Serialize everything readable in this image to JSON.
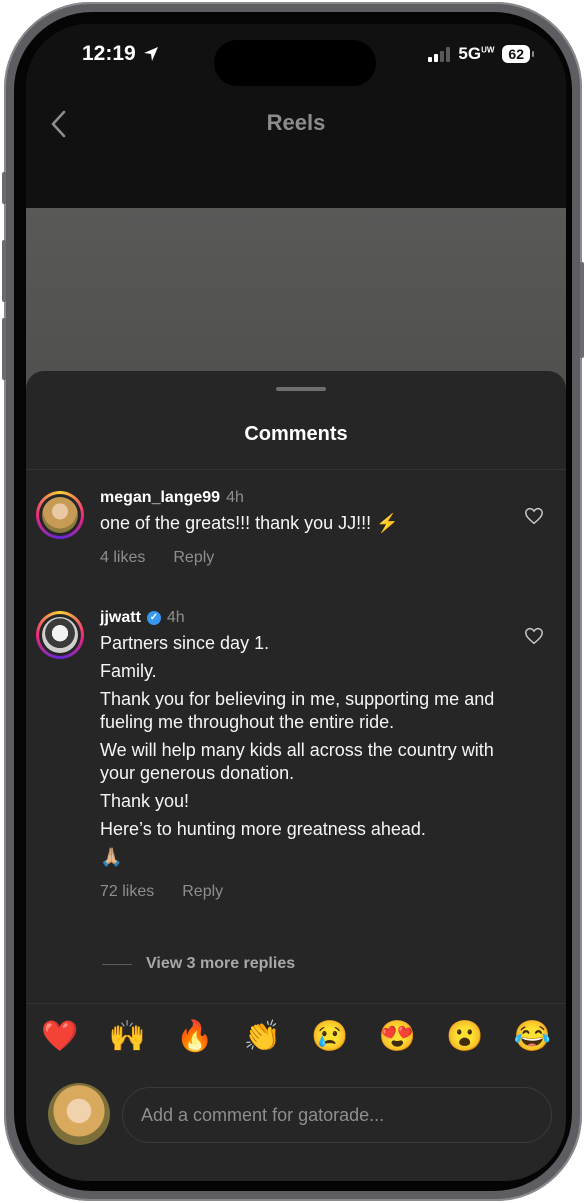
{
  "status_bar": {
    "time": "12:19",
    "network": "5G",
    "network_sup": "UW",
    "battery": "62"
  },
  "header": {
    "title": "Reels"
  },
  "comments_sheet": {
    "title": "Comments",
    "comments": [
      {
        "username": "megan_lange99",
        "time_ago": "4h",
        "text": "one of the greats!!! thank you JJ!!! ⚡",
        "likes": "4 likes",
        "reply_label": "Reply"
      },
      {
        "username": "jjwatt",
        "verified": true,
        "time_ago": "4h",
        "lines": [
          "Partners since day 1.",
          "Family.",
          "Thank you for believing in me, supporting me and fueling me throughout the entire ride.",
          "We will help many kids all across the country with your generous donation.",
          "Thank you!",
          "Here’s to hunting more greatness ahead.",
          "🙏🏼"
        ],
        "likes": "72 likes",
        "reply_label": "Reply"
      }
    ],
    "view_replies": "View 3 more replies"
  },
  "emoji_bar": [
    "❤️",
    "🙌",
    "🔥",
    "👏",
    "😢",
    "😍",
    "😮",
    "😂"
  ],
  "input": {
    "placeholder": "Add a comment for gatorade..."
  },
  "colors": {
    "sheet_bg": "#262626",
    "accent_verified": "#3897f0"
  }
}
